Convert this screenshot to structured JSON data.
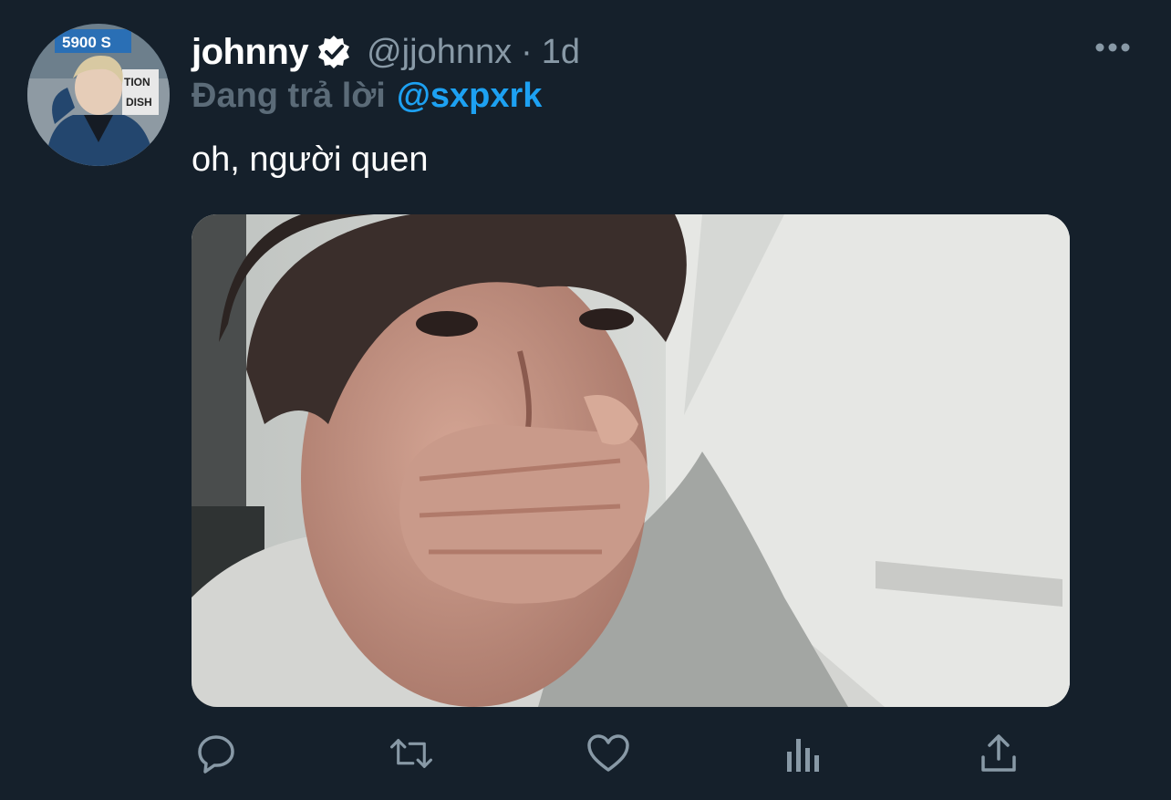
{
  "tweet": {
    "display_name": "johnny",
    "handle": "@jjohnnx",
    "separator": "·",
    "time": "1d",
    "reply_prefix": "Đang trả lời",
    "reply_to": "@sxpxrk",
    "text": "oh, người quen"
  },
  "avatar_sign": {
    "line1": "5900 S",
    "line2": "TION",
    "line3": "DISH"
  },
  "icons": {
    "verified": "verified-badge-icon",
    "more": "more-horizontal-icon",
    "reply": "reply-icon",
    "retweet": "retweet-icon",
    "like": "heart-icon",
    "analytics": "analytics-icon",
    "share": "share-icon"
  },
  "colors": {
    "background": "#15202b",
    "text_primary": "#ffffff",
    "text_secondary": "#8899a6",
    "accent": "#1da1f2"
  }
}
